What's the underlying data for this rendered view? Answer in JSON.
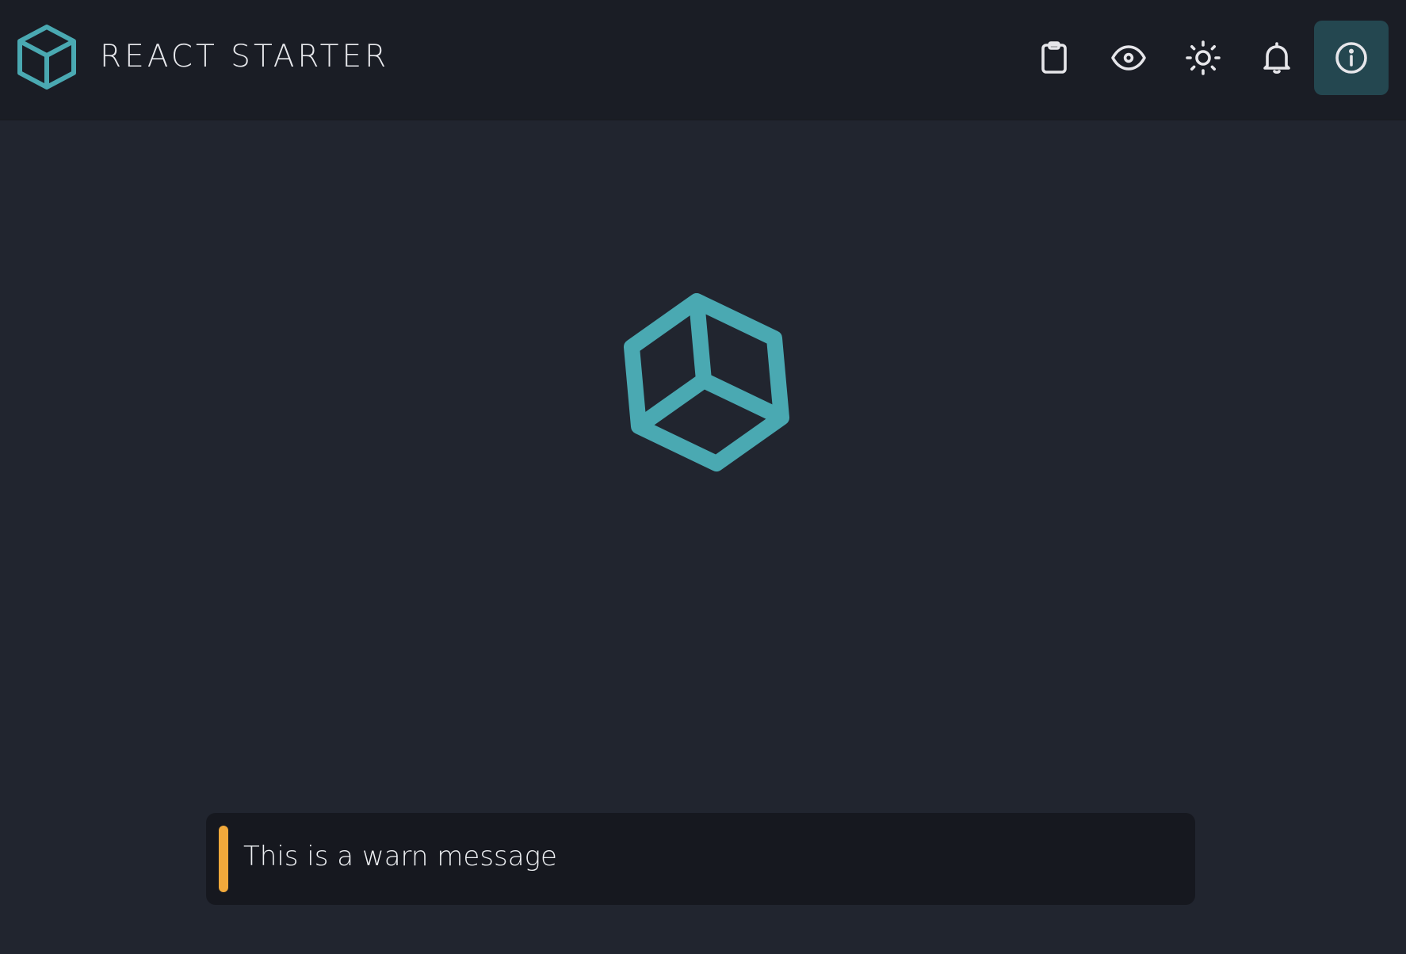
{
  "header": {
    "title": "REACT STARTER",
    "logo_icon": "cube-icon",
    "actions": [
      {
        "icon": "clipboard-icon"
      },
      {
        "icon": "eye-icon"
      },
      {
        "icon": "sun-icon"
      },
      {
        "icon": "bell-icon"
      },
      {
        "icon": "info-icon",
        "active": true
      }
    ]
  },
  "main": {
    "loader_icon": "cube-icon"
  },
  "toast": {
    "level": "warn",
    "message": "This is a warn message"
  },
  "colors": {
    "accent": "#4aa9b2",
    "header_bg": "#1a1d25",
    "page_bg": "#21252f",
    "toast_bg": "#16181f",
    "warn": "#f2a93b",
    "active_button_bg": "#244750"
  }
}
